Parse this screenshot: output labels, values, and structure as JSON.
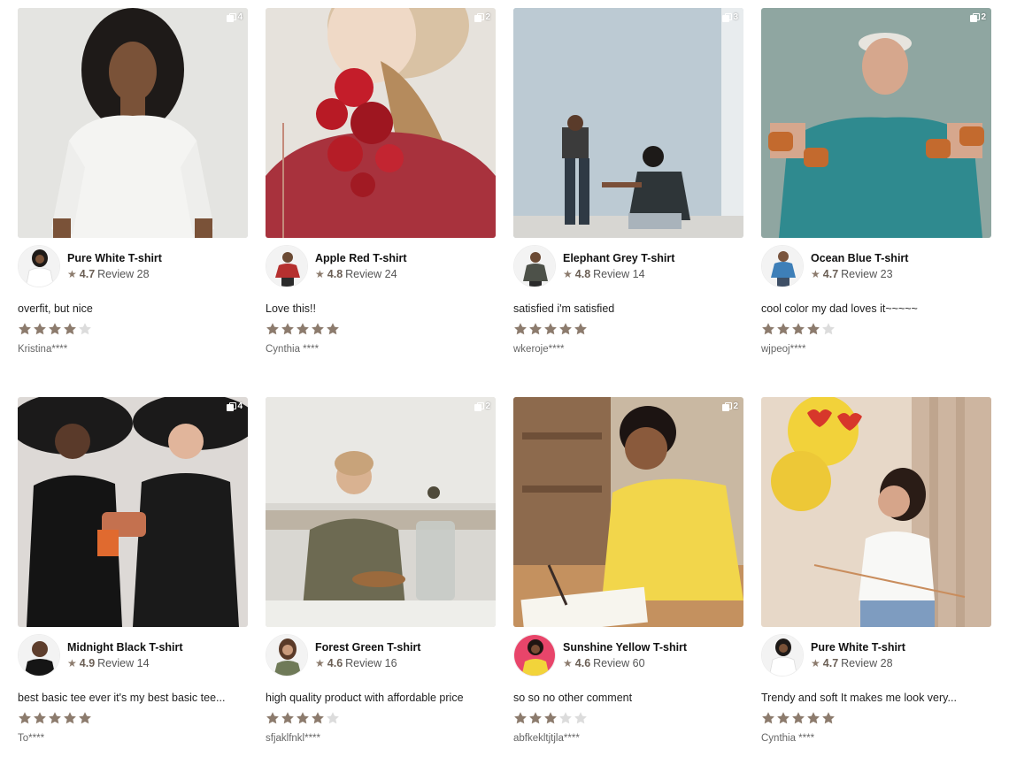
{
  "colors": {
    "star_filled": "#8c7b6d",
    "star_empty": "#dcdcdc"
  },
  "cards": [
    {
      "photo_count": "4",
      "photo_icon": "copy-icon",
      "product_name": "Pure White T-shirt",
      "rating": "4.7",
      "review_label": "Review 28",
      "review_text": "overfit, but nice",
      "stars": 4,
      "reviewer": "Kristina****"
    },
    {
      "photo_count": "2",
      "photo_icon": "copy-icon",
      "product_name": "Apple Red T-shirt",
      "rating": "4.8",
      "review_label": "Review 24",
      "review_text": "Love this!!",
      "stars": 5,
      "reviewer": "Cynthia ****"
    },
    {
      "photo_count": "3",
      "photo_icon": "copy-icon",
      "product_name": "Elephant Grey T-shirt",
      "rating": "4.8",
      "review_label": "Review 14",
      "review_text": "satisfied i'm satisfied",
      "stars": 5,
      "reviewer": "wkeroje****"
    },
    {
      "photo_count": "2",
      "photo_icon": "copy-icon",
      "product_name": "Ocean Blue T-shirt",
      "rating": "4.7",
      "review_label": "Review 23",
      "review_text": "cool color my dad loves it~~~~~",
      "stars": 4,
      "reviewer": "wjpeoj****"
    },
    {
      "photo_count": "4",
      "photo_icon": "copy-icon",
      "product_name": "Midnight Black T-shirt",
      "rating": "4.9",
      "review_label": "Review 14",
      "review_text": "best basic tee ever it's my best basic tee...",
      "stars": 5,
      "reviewer": "To****"
    },
    {
      "photo_count": "2",
      "photo_icon": "copy-icon",
      "product_name": "Forest Green T-shirt",
      "rating": "4.6",
      "review_label": "Review 16",
      "review_text": "high quality product with affordable price",
      "stars": 4,
      "reviewer": "sfjaklfnkl****"
    },
    {
      "photo_count": "2",
      "photo_icon": "copy-icon",
      "product_name": "Sunshine Yellow T-shirt",
      "rating": "4.6",
      "review_label": "Review 60",
      "review_text": "so so no other comment",
      "stars": 3,
      "reviewer": "abfkekltjtjla****"
    },
    {
      "photo_count": "",
      "photo_icon": "",
      "product_name": "Pure White T-shirt",
      "rating": "4.7",
      "review_label": "Review 28",
      "review_text": "Trendy and soft It makes me look very...",
      "stars": 5,
      "reviewer": "Cynthia ****"
    }
  ]
}
